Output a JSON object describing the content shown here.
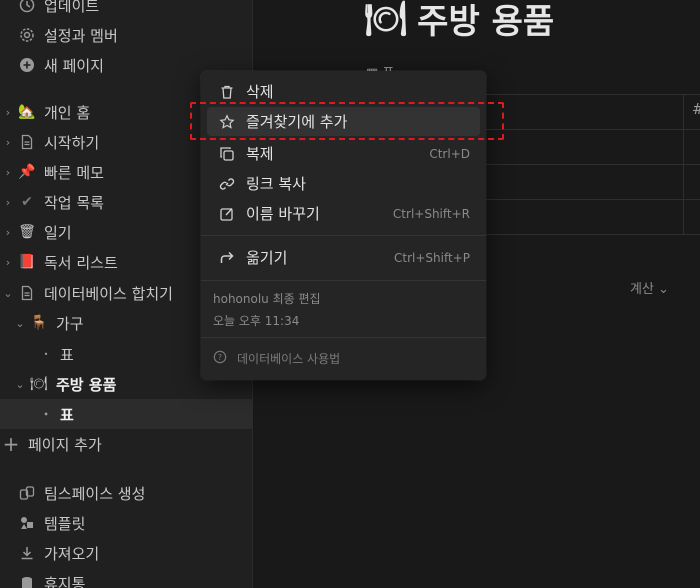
{
  "sidebar": {
    "top_items": [
      {
        "label": "업데이트",
        "icon": "clock-icon"
      },
      {
        "label": "설정과 멤버",
        "icon": "gear-icon"
      },
      {
        "label": "새 페이지",
        "icon": "plus-circle-icon"
      }
    ],
    "pages": [
      {
        "label": "개인 홈",
        "icon": "house-icon",
        "glyph": "🏡"
      },
      {
        "label": "시작하기",
        "icon": "page-icon",
        "glyph": ""
      },
      {
        "label": "빠른 메모",
        "icon": "pin-icon",
        "glyph": "📌"
      },
      {
        "label": "작업 목록",
        "icon": "check-icon",
        "glyph": "✔"
      },
      {
        "label": "일기",
        "icon": "trash-can-icon",
        "glyph": "🗑"
      },
      {
        "label": "독서 리스트",
        "icon": "book-icon",
        "glyph": "📕"
      },
      {
        "label": "데이터베이스 합치기",
        "icon": "page-icon",
        "glyph": ""
      },
      {
        "label": "가구",
        "icon": "chair-icon",
        "glyph": "🪑"
      },
      {
        "label": "표",
        "icon": "bullet-icon",
        "glyph": "•"
      },
      {
        "label": "주방 용품",
        "icon": "kitchen-icon",
        "glyph": "🍽"
      },
      {
        "label": "표",
        "icon": "bullet-icon",
        "glyph": "•"
      }
    ],
    "add_page": "페이지 추가",
    "bottom_items": [
      {
        "label": "팀스페이스 생성",
        "icon": "team-icon"
      },
      {
        "label": "템플릿",
        "icon": "template-icon"
      },
      {
        "label": "가져오기",
        "icon": "download-icon"
      },
      {
        "label": "휴지통",
        "icon": "trash-icon"
      }
    ]
  },
  "main": {
    "title": "주방 용품",
    "title_glyph": "🍽",
    "view_tab": "표",
    "hash_column": "#",
    "calculate": "계산 ⌄"
  },
  "context_menu": {
    "items": [
      {
        "label": "삭제",
        "icon": "trash-icon",
        "shortcut": ""
      },
      {
        "label": "즐겨찾기에 추가",
        "icon": "star-icon",
        "shortcut": ""
      },
      {
        "label": "복제",
        "icon": "duplicate-icon",
        "shortcut": "Ctrl+D"
      },
      {
        "label": "링크 복사",
        "icon": "link-icon",
        "shortcut": ""
      },
      {
        "label": "이름 바꾸기",
        "icon": "rename-icon",
        "shortcut": "Ctrl+Shift+R"
      },
      {
        "label": "옮기기",
        "icon": "move-arrow-icon",
        "shortcut": "Ctrl+Shift+P"
      }
    ],
    "last_edited_by": "hohonolu 최종 편집",
    "last_edited_time": "오늘 오후 11:34",
    "help_label": "데이터베이스 사용법"
  }
}
